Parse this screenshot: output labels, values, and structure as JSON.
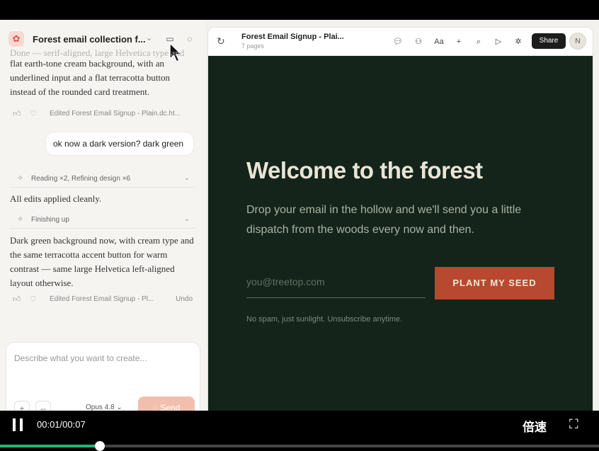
{
  "chat": {
    "title": "Forest email collection f...",
    "logo_icon": "palette-icon",
    "msg1_fade": "Done — serif-aligned, large Helvetica type and",
    "msg1": "flat earth-tone cream background, with an underlined input and a flat terracotta button instead of the rounded card treatment.",
    "edit1": "Edited Forest Email Signup - Plain.dc.ht...",
    "user_msg": "ok now a dark version? dark green",
    "step1": "Reading ×2, Refining design ×6",
    "msg2": "All edits applied cleanly.",
    "step2": "Finishing up",
    "msg3": "Dark green background now, with cream type and the same terracotta accent button for warm contrast — same large Helvetica left-aligned layout otherwise.",
    "edit2": "Edited Forest Email Signup - Pl...",
    "undo": "Undo"
  },
  "composer": {
    "placeholder": "Describe what you want to create...",
    "model": "Opus 4.8",
    "send": "Send"
  },
  "preview": {
    "title": "Forest Email Signup - Plai...",
    "pages": "7 pages",
    "share": "Share",
    "avatar": "N"
  },
  "page": {
    "heading": "Welcome to the forest",
    "description": "Drop your email in the hollow and we'll send you a little dispatch from the woods every now and then.",
    "email_placeholder": "you@treetop.com",
    "cta": "PLANT MY SEED",
    "fine_print": "No spam, just sunlight. Unsubscribe anytime.",
    "colors": {
      "background": "#14241b",
      "accent": "#b8482f",
      "cream": "#e9e4d6"
    }
  },
  "video": {
    "time": "00:01/00:07",
    "speed": "倍速",
    "progress": 0.167
  }
}
